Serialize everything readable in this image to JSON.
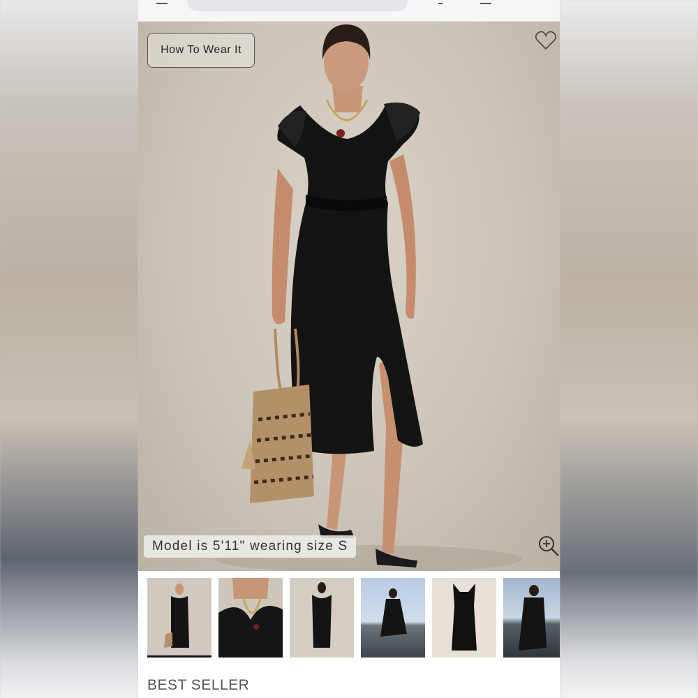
{
  "hero": {
    "how_to_wear_label": "How To Wear It",
    "model_note": "Model is 5'11\" wearing size S"
  },
  "icons": {
    "favorite": "heart-icon",
    "zoom": "zoom-in-icon"
  },
  "product": {
    "badge": "BEST SELLER"
  },
  "thumbnails": [
    {
      "view": "full-front-with-bag",
      "active": true
    },
    {
      "view": "neckline-detail",
      "active": false
    },
    {
      "view": "full-back",
      "active": false
    },
    {
      "view": "beach-action",
      "active": false
    },
    {
      "view": "flat-lay",
      "active": false
    },
    {
      "view": "beach-standing",
      "active": false
    }
  ],
  "colors": {
    "dress": "#111111",
    "backdrop": "#cbc4b8",
    "active_indicator": "#111111"
  }
}
